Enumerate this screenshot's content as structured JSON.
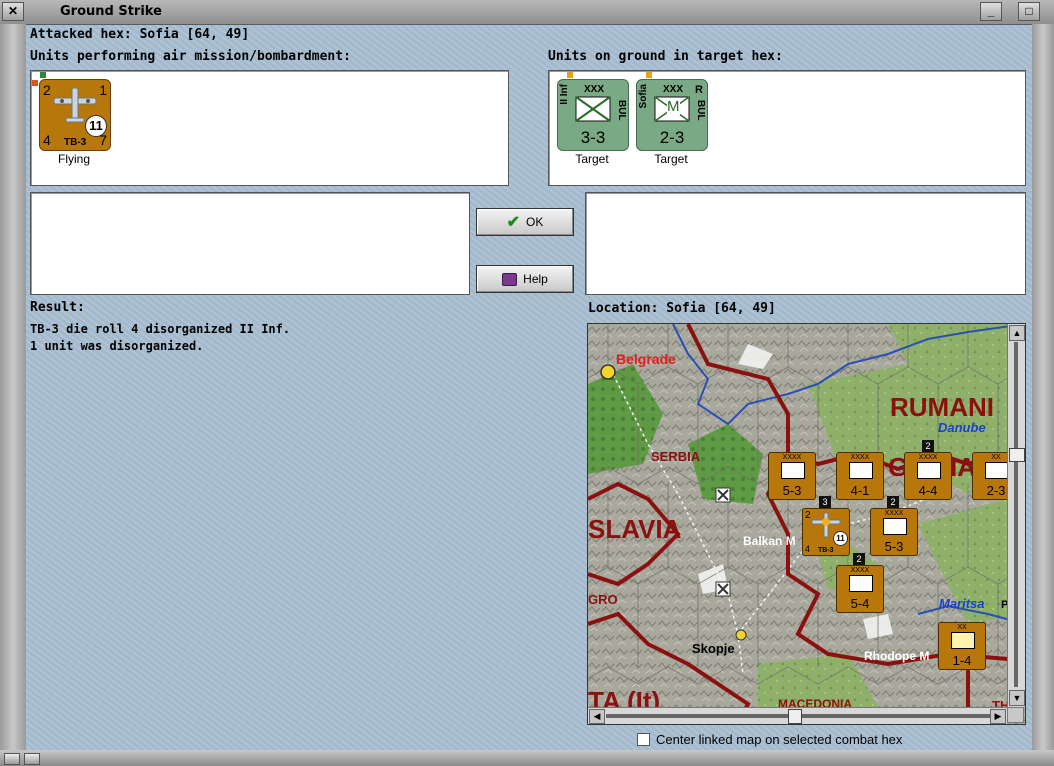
{
  "window": {
    "title": "Ground Strike"
  },
  "attacked_hex": "Attacked hex: Sofia  [64, 49]",
  "air_panel": {
    "label": "Units performing air mission/bombardment:",
    "units": [
      {
        "top_left": "2",
        "top_right": "1",
        "bottom_left": "4",
        "bottom_right": "7",
        "circle": "11",
        "name": "TB-3",
        "status": "Flying",
        "icon": "bomber-plane-icon"
      }
    ]
  },
  "ground_panel": {
    "label": "Units on ground in target hex:",
    "units": [
      {
        "side": "II Inf",
        "size": "XXX",
        "nation": "BUL",
        "combat": "3-3",
        "status": "Target",
        "icon": "infantry-icon",
        "flag": ""
      },
      {
        "side": "Sofia",
        "size": "XXX",
        "nation": "BUL",
        "flag": "R",
        "combat": "2-3",
        "status": "Target",
        "icon": "militia-icon",
        "symbol": "M"
      }
    ]
  },
  "buttons": {
    "ok": "OK",
    "help": "Help"
  },
  "result": {
    "label": "Result:",
    "lines": [
      "TB-3 die roll 4 disorganized II Inf.",
      "1 unit was disorganized."
    ]
  },
  "location": "Location:  Sofia  [64, 49]",
  "map": {
    "labels": {
      "belgrade": "Belgrade",
      "rumania": "RUMANI",
      "danube": "Danube",
      "serbia": "SERBIA",
      "slavia": "SLAVIA",
      "balkan": "Balkan M",
      "gro": "GRO",
      "skopje": "Skopje",
      "maritsa": "Maritsa",
      "rhodope": "Rhodope M",
      "ta": "TA (It)",
      "macedonia": "MACEDONIA",
      "bulgaria_b": "B",
      "bulgaria_g": "G",
      "bulgaria_ia": "IA",
      "p": "P",
      "th": "TH"
    },
    "counters": [
      {
        "combat": "5-3",
        "size": "XXXX"
      },
      {
        "combat": "4-1",
        "size": "XXXX"
      },
      {
        "combat": "4-4",
        "size": "XXXX"
      },
      {
        "combat": "2-3",
        "size": "XX"
      },
      {
        "combat": "5-3",
        "size": "XXXX"
      },
      {
        "combat": "5-4",
        "size": "XXXX"
      },
      {
        "combat": "1-4",
        "size": "XX"
      }
    ],
    "stack_counts": [
      "2",
      "3",
      "2",
      "2"
    ],
    "mini_air": {
      "top_left": "2",
      "bottom_left": "4",
      "circle": "11",
      "name": "TB-3"
    }
  },
  "checkbox": {
    "label": "Center linked map on selected combat hex"
  },
  "colors": {
    "background": "#a9bfd3",
    "air_counter": "#b8770a",
    "ground_counter": "#79a985",
    "border_line": "#8b1010"
  }
}
